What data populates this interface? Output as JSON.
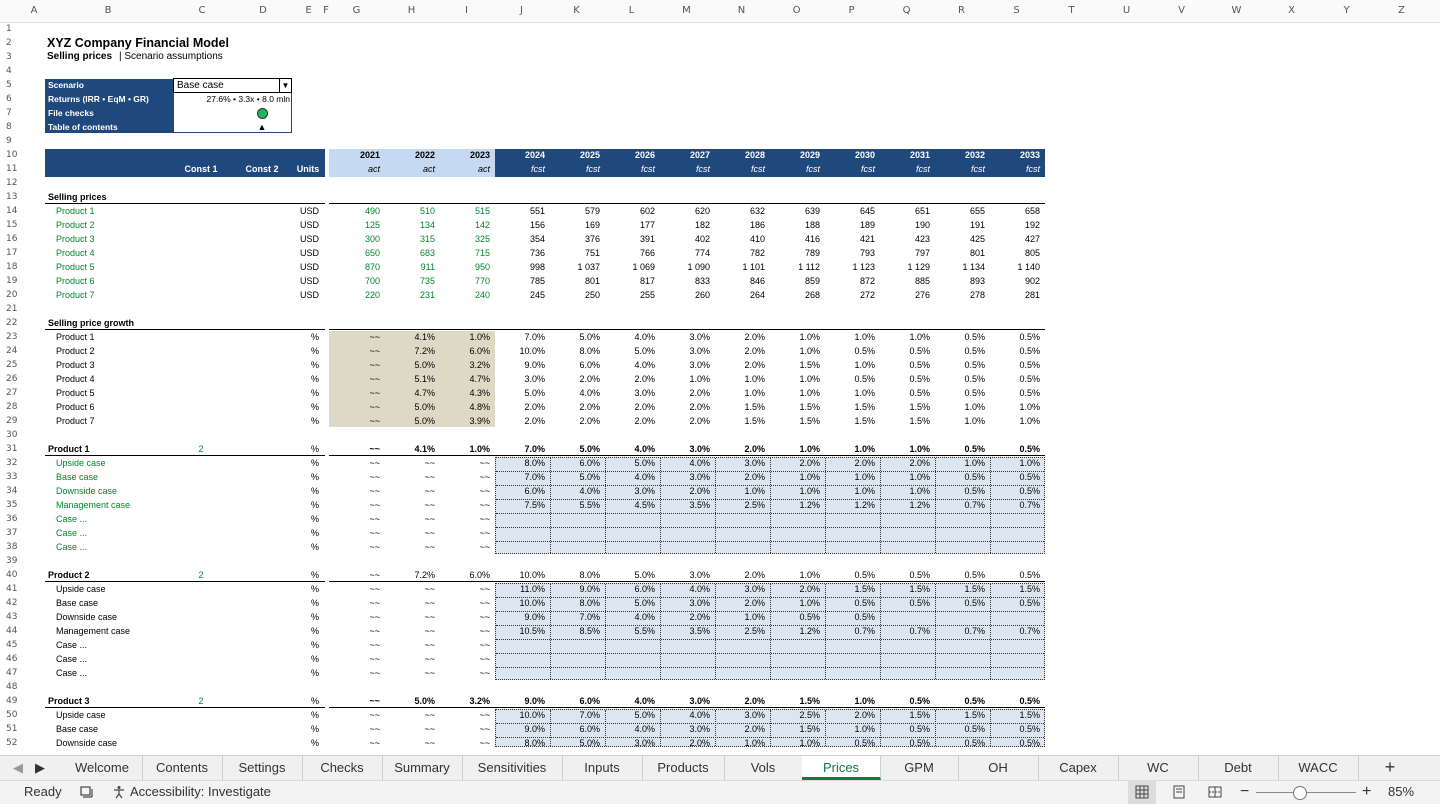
{
  "column_headers": [
    "A",
    "B",
    "C",
    "D",
    "E",
    "F",
    "G",
    "H",
    "I",
    "J",
    "K",
    "L",
    "M",
    "N",
    "O",
    "P",
    "Q",
    "R",
    "S",
    "T",
    "U",
    "V",
    "W",
    "X",
    "Y",
    "Z"
  ],
  "header": {
    "company": "XYZ Company Financial Model",
    "page_title": "Selling prices",
    "page_subtitle": "| Scenario assumptions"
  },
  "info_box": {
    "scenario_label": "Scenario",
    "scenario_value": "Base case",
    "returns_label": "Returns (IRR • EqM • GR)",
    "returns_value": "27.6% • 3.3x • 8.0 mln",
    "file_checks_label": "File checks",
    "toc_label": "Table of contents",
    "toc_glyph": "▲",
    "status_color": "#1fb35a"
  },
  "table_header": {
    "const1": "Const 1",
    "const2": "Const 2",
    "units": "Units",
    "years": [
      "2021",
      "2022",
      "2023",
      "2024",
      "2025",
      "2026",
      "2027",
      "2028",
      "2029",
      "2030",
      "2031",
      "2032",
      "2033"
    ],
    "kinds": [
      "act",
      "act",
      "act",
      "fcst",
      "fcst",
      "fcst",
      "fcst",
      "fcst",
      "fcst",
      "fcst",
      "fcst",
      "fcst",
      "fcst"
    ]
  },
  "rows": [
    {
      "r": 13,
      "label": "Selling prices",
      "style": "section"
    },
    {
      "r": 14,
      "label": "Product 1",
      "style": "green",
      "units": "USD",
      "vals": [
        "490",
        "510",
        "515",
        "551",
        "579",
        "602",
        "620",
        "632",
        "639",
        "645",
        "651",
        "655",
        "658"
      ]
    },
    {
      "r": 15,
      "label": "Product 2",
      "style": "green",
      "units": "USD",
      "vals": [
        "125",
        "134",
        "142",
        "156",
        "169",
        "177",
        "182",
        "186",
        "188",
        "189",
        "190",
        "191",
        "192"
      ]
    },
    {
      "r": 16,
      "label": "Product 3",
      "style": "green",
      "units": "USD",
      "vals": [
        "300",
        "315",
        "325",
        "354",
        "376",
        "391",
        "402",
        "410",
        "416",
        "421",
        "423",
        "425",
        "427"
      ]
    },
    {
      "r": 17,
      "label": "Product 4",
      "style": "green",
      "units": "USD",
      "vals": [
        "650",
        "683",
        "715",
        "736",
        "751",
        "766",
        "774",
        "782",
        "789",
        "793",
        "797",
        "801",
        "805"
      ]
    },
    {
      "r": 18,
      "label": "Product 5",
      "style": "green",
      "units": "USD",
      "vals": [
        "870",
        "911",
        "950",
        "998",
        "1 037",
        "1 069",
        "1 090",
        "1 101",
        "1 112",
        "1 123",
        "1 129",
        "1 134",
        "1 140"
      ]
    },
    {
      "r": 19,
      "label": "Product 6",
      "style": "green",
      "units": "USD",
      "vals": [
        "700",
        "735",
        "770",
        "785",
        "801",
        "817",
        "833",
        "846",
        "859",
        "872",
        "885",
        "893",
        "902"
      ]
    },
    {
      "r": 20,
      "label": "Product 7",
      "style": "green",
      "units": "USD",
      "vals": [
        "220",
        "231",
        "240",
        "245",
        "250",
        "255",
        "260",
        "264",
        "268",
        "272",
        "276",
        "278",
        "281"
      ]
    },
    {
      "r": 22,
      "label": "Selling price growth",
      "style": "section"
    },
    {
      "r": 23,
      "label": "Product 1",
      "style": "plain",
      "units": "%",
      "vals": [
        "~~",
        "4.1%",
        "1.0%",
        "7.0%",
        "5.0%",
        "4.0%",
        "3.0%",
        "2.0%",
        "1.0%",
        "1.0%",
        "1.0%",
        "0.5%",
        "0.5%"
      ]
    },
    {
      "r": 24,
      "label": "Product 2",
      "style": "plain",
      "units": "%",
      "vals": [
        "~~",
        "7.2%",
        "6.0%",
        "10.0%",
        "8.0%",
        "5.0%",
        "3.0%",
        "2.0%",
        "1.0%",
        "0.5%",
        "0.5%",
        "0.5%",
        "0.5%"
      ]
    },
    {
      "r": 25,
      "label": "Product 3",
      "style": "plain",
      "units": "%",
      "vals": [
        "~~",
        "5.0%",
        "3.2%",
        "9.0%",
        "6.0%",
        "4.0%",
        "3.0%",
        "2.0%",
        "1.5%",
        "1.0%",
        "0.5%",
        "0.5%",
        "0.5%"
      ]
    },
    {
      "r": 26,
      "label": "Product 4",
      "style": "plain",
      "units": "%",
      "vals": [
        "~~",
        "5.1%",
        "4.7%",
        "3.0%",
        "2.0%",
        "2.0%",
        "1.0%",
        "1.0%",
        "1.0%",
        "0.5%",
        "0.5%",
        "0.5%",
        "0.5%"
      ]
    },
    {
      "r": 27,
      "label": "Product 5",
      "style": "plain",
      "units": "%",
      "vals": [
        "~~",
        "4.7%",
        "4.3%",
        "5.0%",
        "4.0%",
        "3.0%",
        "2.0%",
        "1.0%",
        "1.0%",
        "1.0%",
        "0.5%",
        "0.5%",
        "0.5%"
      ]
    },
    {
      "r": 28,
      "label": "Product 6",
      "style": "plain",
      "units": "%",
      "vals": [
        "~~",
        "5.0%",
        "4.8%",
        "2.0%",
        "2.0%",
        "2.0%",
        "2.0%",
        "1.5%",
        "1.5%",
        "1.5%",
        "1.5%",
        "1.0%",
        "1.0%"
      ]
    },
    {
      "r": 29,
      "label": "Product 7",
      "style": "plain",
      "units": "%",
      "vals": [
        "~~",
        "5.0%",
        "3.9%",
        "2.0%",
        "2.0%",
        "2.0%",
        "2.0%",
        "1.5%",
        "1.5%",
        "1.5%",
        "1.5%",
        "1.0%",
        "1.0%"
      ]
    },
    {
      "r": 31,
      "label": "Product 1",
      "style": "sub",
      "const1": "2",
      "units": "%",
      "vals": [
        "~~",
        "4.1%",
        "1.0%",
        "7.0%",
        "5.0%",
        "4.0%",
        "3.0%",
        "2.0%",
        "1.0%",
        "1.0%",
        "1.0%",
        "0.5%",
        "0.5%"
      ]
    },
    {
      "r": 32,
      "label": "Upside case",
      "style": "case-green",
      "units": "%",
      "vals": [
        "~~",
        "~~",
        "~~",
        "8.0%",
        "6.0%",
        "5.0%",
        "4.0%",
        "3.0%",
        "2.0%",
        "2.0%",
        "2.0%",
        "1.0%",
        "1.0%"
      ]
    },
    {
      "r": 33,
      "label": "Base case",
      "style": "case-green",
      "units": "%",
      "vals": [
        "~~",
        "~~",
        "~~",
        "7.0%",
        "5.0%",
        "4.0%",
        "3.0%",
        "2.0%",
        "1.0%",
        "1.0%",
        "1.0%",
        "0.5%",
        "0.5%"
      ]
    },
    {
      "r": 34,
      "label": "Downside case",
      "style": "case-green",
      "units": "%",
      "vals": [
        "~~",
        "~~",
        "~~",
        "6.0%",
        "4.0%",
        "3.0%",
        "2.0%",
        "1.0%",
        "1.0%",
        "1.0%",
        "1.0%",
        "0.5%",
        "0.5%"
      ]
    },
    {
      "r": 35,
      "label": "Management case",
      "style": "case-green",
      "units": "%",
      "vals": [
        "~~",
        "~~",
        "~~",
        "7.5%",
        "5.5%",
        "4.5%",
        "3.5%",
        "2.5%",
        "1.2%",
        "1.2%",
        "1.2%",
        "0.7%",
        "0.7%"
      ]
    },
    {
      "r": 36,
      "label": "Case ...",
      "style": "case-green",
      "units": "%",
      "vals": [
        "~~",
        "~~",
        "~~",
        "",
        "",
        "",
        "",
        "",
        "",
        "",
        "",
        "",
        ""
      ]
    },
    {
      "r": 37,
      "label": "Case ...",
      "style": "case-green",
      "units": "%",
      "vals": [
        "~~",
        "~~",
        "~~",
        "",
        "",
        "",
        "",
        "",
        "",
        "",
        "",
        "",
        ""
      ]
    },
    {
      "r": 38,
      "label": "Case ...",
      "style": "case-green",
      "units": "%",
      "vals": [
        "~~",
        "~~",
        "~~",
        "",
        "",
        "",
        "",
        "",
        "",
        "",
        "",
        "",
        ""
      ]
    },
    {
      "r": 40,
      "label": "Product 2",
      "style": "sub-plain",
      "const1": "2",
      "units": "%",
      "vals": [
        "~~",
        "7.2%",
        "6.0%",
        "10.0%",
        "8.0%",
        "5.0%",
        "3.0%",
        "2.0%",
        "1.0%",
        "0.5%",
        "0.5%",
        "0.5%",
        "0.5%"
      ]
    },
    {
      "r": 41,
      "label": "Upside case",
      "style": "case",
      "units": "%",
      "vals": [
        "~~",
        "~~",
        "~~",
        "11.0%",
        "9.0%",
        "6.0%",
        "4.0%",
        "3.0%",
        "2.0%",
        "1.5%",
        "1.5%",
        "1.5%",
        "1.5%"
      ]
    },
    {
      "r": 42,
      "label": "Base case",
      "style": "case",
      "units": "%",
      "vals": [
        "~~",
        "~~",
        "~~",
        "10.0%",
        "8.0%",
        "5.0%",
        "3.0%",
        "2.0%",
        "1.0%",
        "0.5%",
        "0.5%",
        "0.5%",
        "0.5%"
      ]
    },
    {
      "r": 43,
      "label": "Downside case",
      "style": "case",
      "units": "%",
      "vals": [
        "~~",
        "~~",
        "~~",
        "9.0%",
        "7.0%",
        "4.0%",
        "2.0%",
        "1.0%",
        "0.5%",
        "0.5%",
        "",
        "",
        ""
      ]
    },
    {
      "r": 44,
      "label": "Management case",
      "style": "case",
      "units": "%",
      "vals": [
        "~~",
        "~~",
        "~~",
        "10.5%",
        "8.5%",
        "5.5%",
        "3.5%",
        "2.5%",
        "1.2%",
        "0.7%",
        "0.7%",
        "0.7%",
        "0.7%"
      ]
    },
    {
      "r": 45,
      "label": "Case ...",
      "style": "case",
      "units": "%",
      "vals": [
        "~~",
        "~~",
        "~~",
        "",
        "",
        "",
        "",
        "",
        "",
        "",
        "",
        "",
        ""
      ]
    },
    {
      "r": 46,
      "label": "Case ...",
      "style": "case",
      "units": "%",
      "vals": [
        "~~",
        "~~",
        "~~",
        "",
        "",
        "",
        "",
        "",
        "",
        "",
        "",
        "",
        ""
      ]
    },
    {
      "r": 47,
      "label": "Case ...",
      "style": "case",
      "units": "%",
      "vals": [
        "~~",
        "~~",
        "~~",
        "",
        "",
        "",
        "",
        "",
        "",
        "",
        "",
        "",
        ""
      ]
    },
    {
      "r": 49,
      "label": "Product 3",
      "style": "sub",
      "const1": "2",
      "units": "%",
      "vals": [
        "~~",
        "5.0%",
        "3.2%",
        "9.0%",
        "6.0%",
        "4.0%",
        "3.0%",
        "2.0%",
        "1.5%",
        "1.0%",
        "0.5%",
        "0.5%",
        "0.5%"
      ]
    },
    {
      "r": 50,
      "label": "Upside case",
      "style": "case",
      "units": "%",
      "vals": [
        "~~",
        "~~",
        "~~",
        "10.0%",
        "7.0%",
        "5.0%",
        "4.0%",
        "3.0%",
        "2.5%",
        "2.0%",
        "1.5%",
        "1.5%",
        "1.5%"
      ]
    },
    {
      "r": 51,
      "label": "Base case",
      "style": "case",
      "units": "%",
      "vals": [
        "~~",
        "~~",
        "~~",
        "9.0%",
        "6.0%",
        "4.0%",
        "3.0%",
        "2.0%",
        "1.5%",
        "1.0%",
        "0.5%",
        "0.5%",
        "0.5%"
      ]
    },
    {
      "r": 52,
      "label": "Downside case",
      "style": "case",
      "units": "%",
      "vals": [
        "~~",
        "~~",
        "~~",
        "8.0%",
        "5.0%",
        "3.0%",
        "2.0%",
        "1.0%",
        "1.0%",
        "0.5%",
        "0.5%",
        "0.5%",
        "0.5%"
      ]
    }
  ],
  "tabs": [
    "Welcome",
    "Contents",
    "Settings",
    "Checks",
    "Summary",
    "Sensitivities",
    "Inputs",
    "Products",
    "Vols",
    "Prices",
    "GPM",
    "OH",
    "Capex",
    "WC",
    "Debt",
    "WACC"
  ],
  "active_tab": "Prices",
  "add_sheet_glyph": "+",
  "status": {
    "ready": "Ready",
    "accessibility": "Accessibility: Investigate",
    "zoom": "85%",
    "zoom_fraction": 0.85
  },
  "colors": {
    "header_navy": "#1f497d",
    "act_blue": "#c5d9f1",
    "input_blue": "#dce6f1",
    "khaki": "#ddd9c4",
    "green_text": "#00872a",
    "tab_green": "#107c41"
  }
}
